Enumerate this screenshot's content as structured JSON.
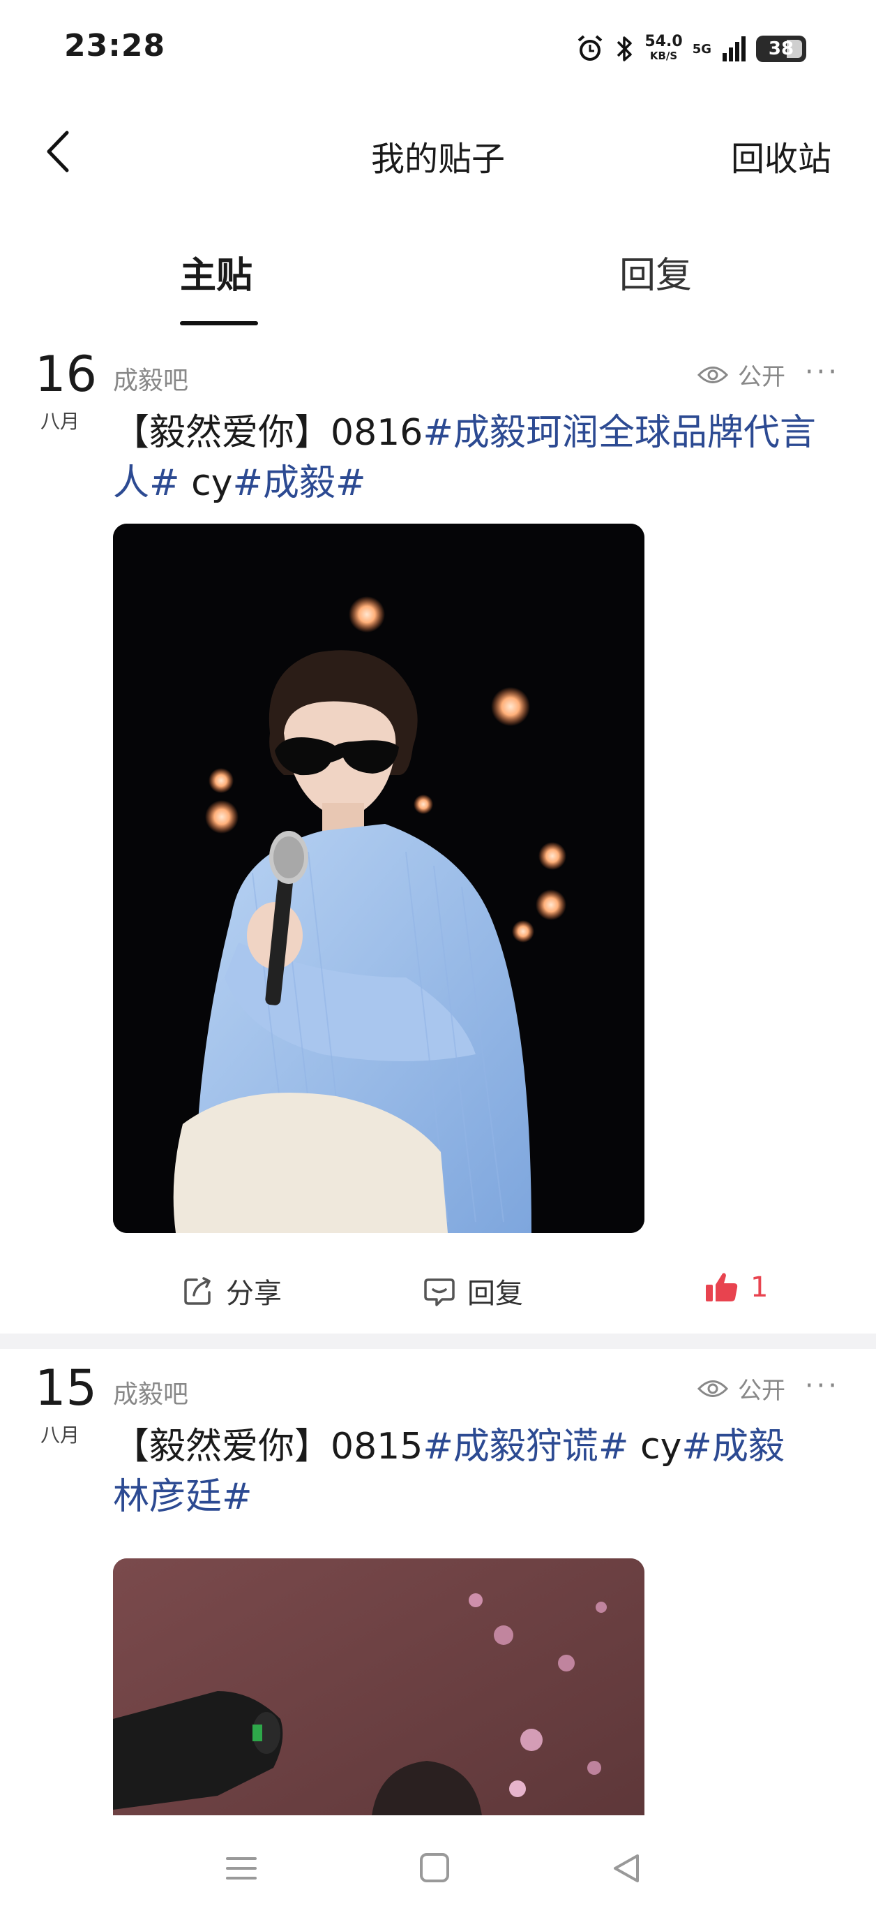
{
  "status_bar": {
    "time": "23:28",
    "net_speed_value": "54.0",
    "net_speed_unit": "KB/S",
    "network": "5G",
    "battery": "38",
    "icons": [
      "alarm-icon",
      "bluetooth-icon",
      "signal-icon",
      "battery-icon"
    ]
  },
  "nav": {
    "title": "我的贴子",
    "right_action": "回收站"
  },
  "tabs": [
    {
      "label": "主贴",
      "active": true
    },
    {
      "label": "回复",
      "active": false
    }
  ],
  "posts": [
    {
      "day": "16",
      "month": "八月",
      "forum": "成毅吧",
      "visibility": "公开",
      "title_plain": "【毅然爱你】0816",
      "tag1": "#成毅珂润全球品牌代言人#",
      "title_mid": " cy",
      "tag2": "#成毅#",
      "actions": {
        "share": "分享",
        "reply": "回复",
        "likes": "1"
      }
    },
    {
      "day": "15",
      "month": "八月",
      "forum": "成毅吧",
      "visibility": "公开",
      "title_plain": "【毅然爱你】0815",
      "tag1": "#成毅狩谎#",
      "title_mid": " cy",
      "tag2": "#成毅林彦廷#"
    }
  ],
  "colors": {
    "tag": "#2c4a92",
    "like": "#e8434f",
    "muted": "#888888",
    "divider": "#f2f2f4"
  }
}
